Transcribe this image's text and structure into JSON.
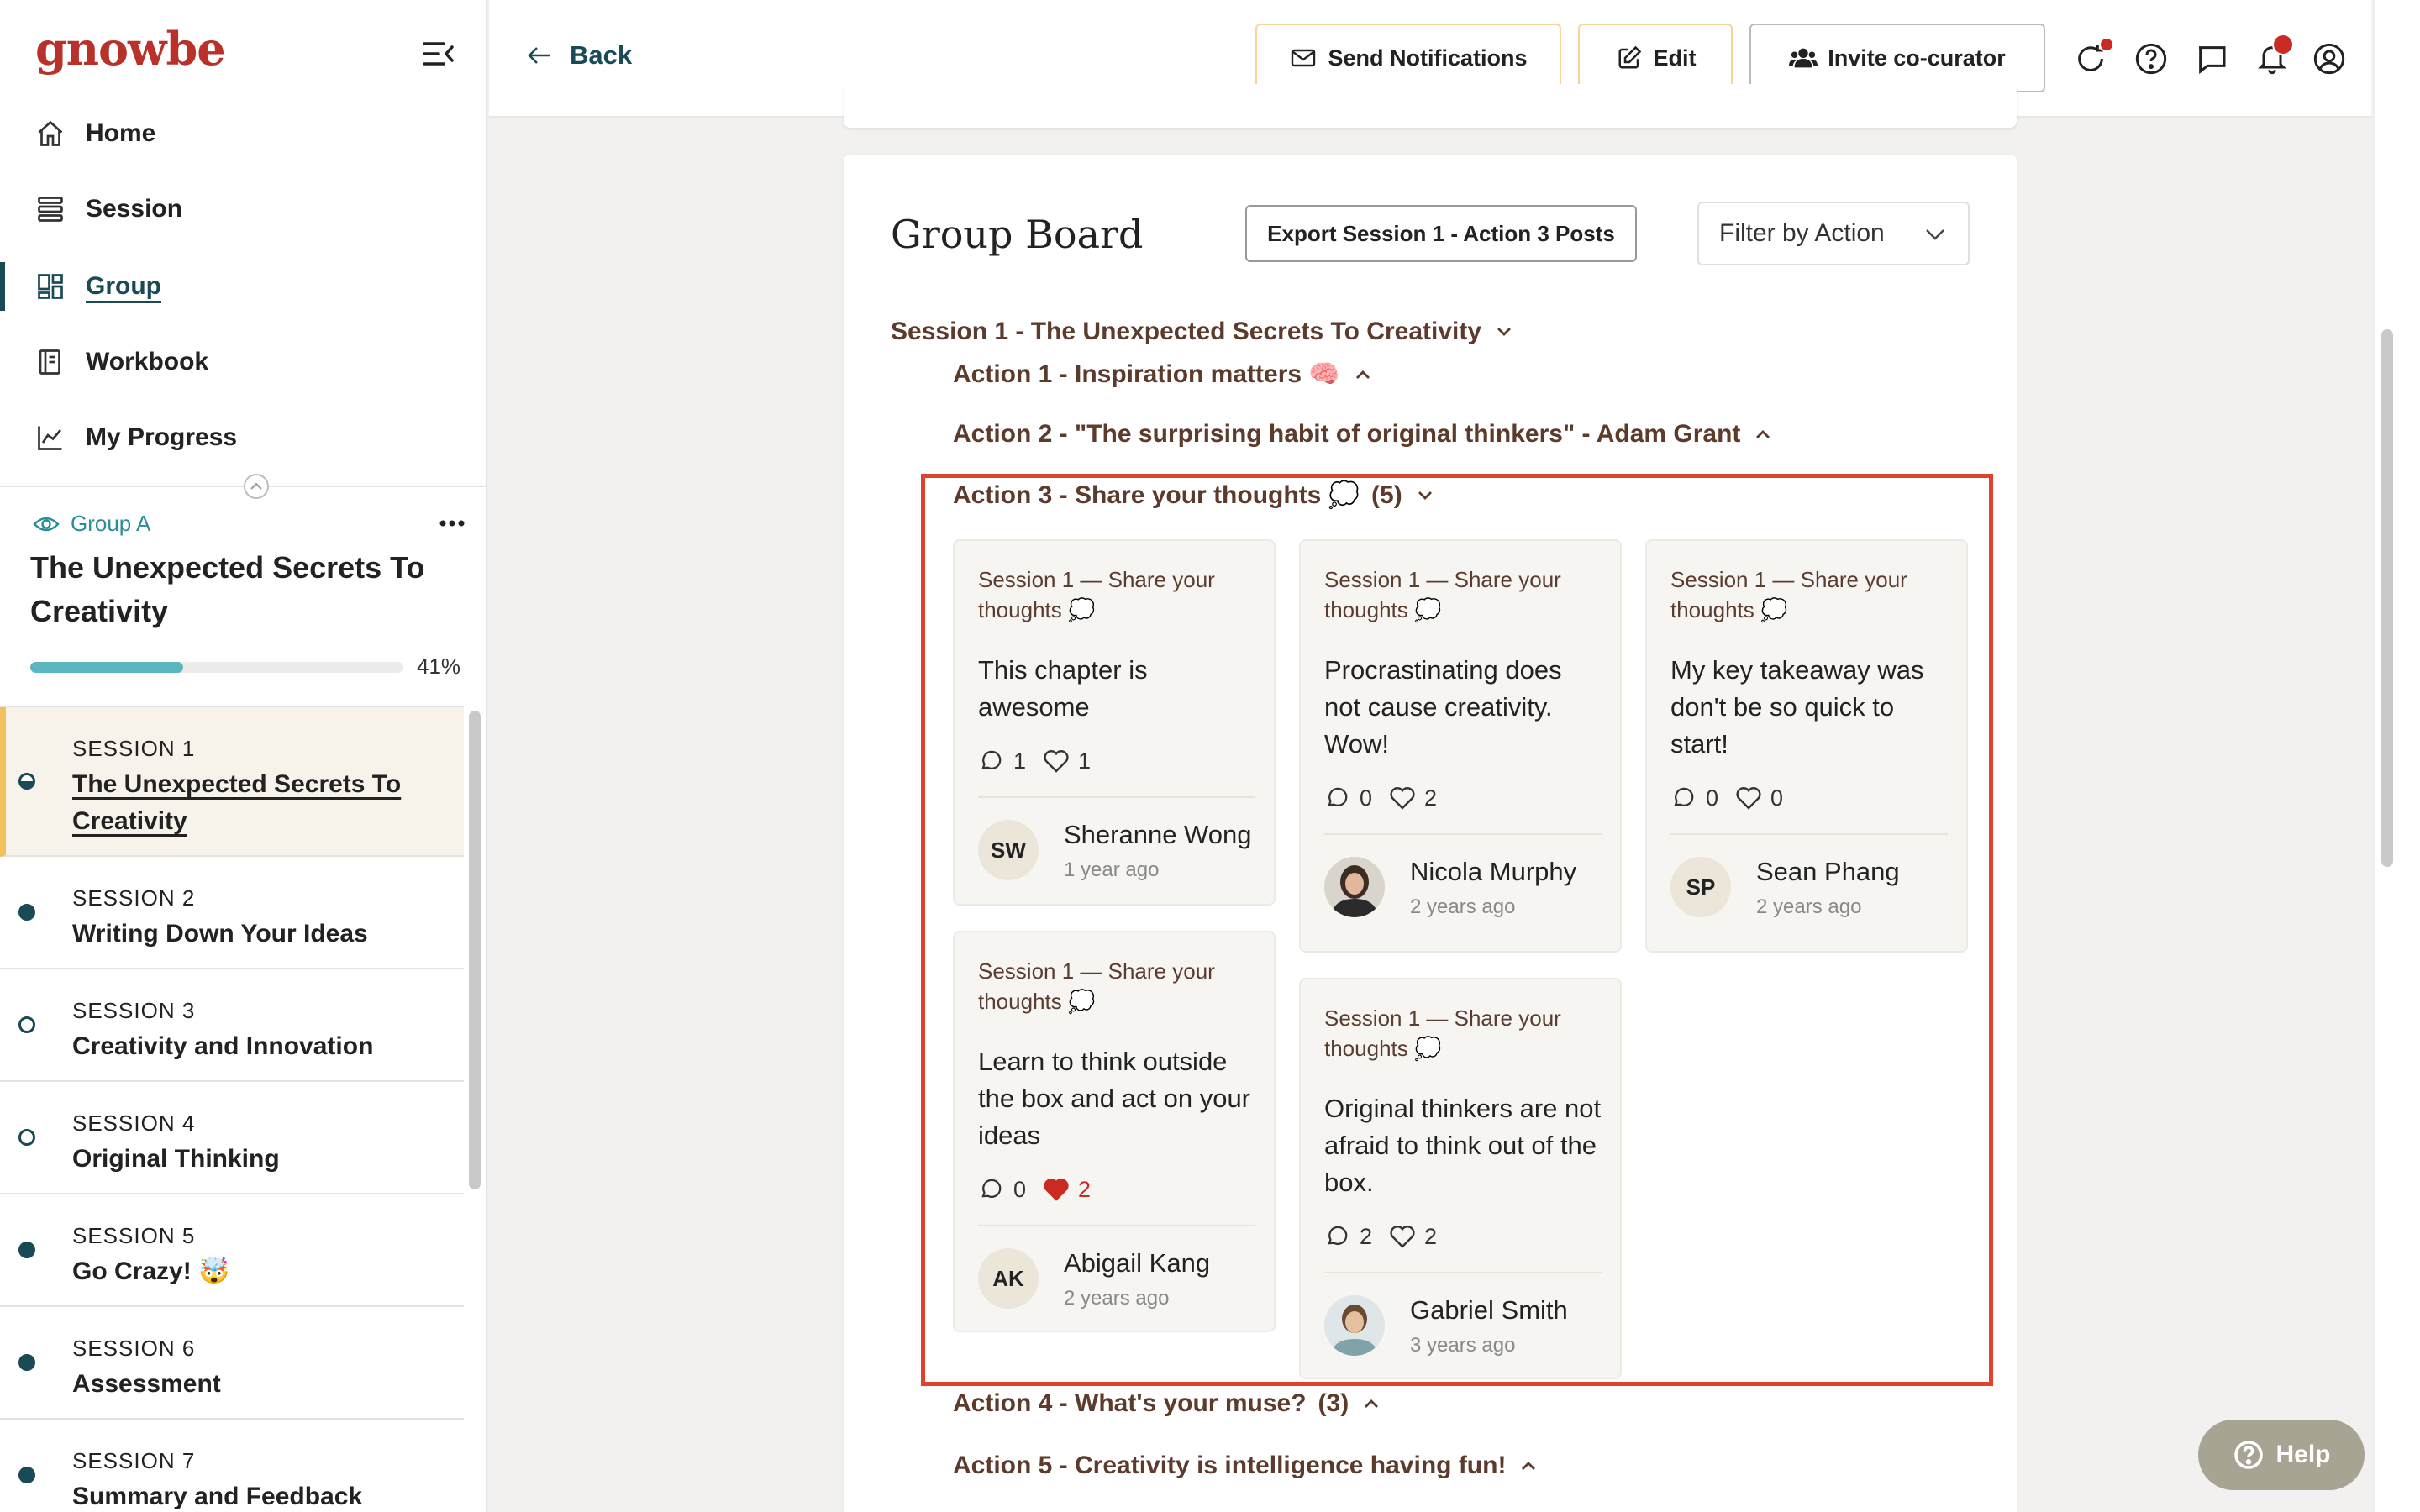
{
  "brand": {
    "logo": "gnowbe"
  },
  "nav": [
    {
      "label": "Home",
      "icon": "home-icon"
    },
    {
      "label": "Session",
      "icon": "stack-icon"
    },
    {
      "label": "Group",
      "icon": "dashboard-icon"
    },
    {
      "label": "Workbook",
      "icon": "notebook-icon"
    },
    {
      "label": "My Progress",
      "icon": "chart-line-icon"
    }
  ],
  "group": {
    "label": "Group A",
    "course_title": "The Unexpected Secrets To Creativity",
    "progress": {
      "percent": 41,
      "label": "41%"
    }
  },
  "sessions": [
    {
      "num": "SESSION 1",
      "name": "The Unexpected Secrets To Creativity",
      "active": true
    },
    {
      "num": "SESSION 2",
      "name": "Writing Down Your Ideas"
    },
    {
      "num": "SESSION 3",
      "name": "Creativity and Innovation"
    },
    {
      "num": "SESSION 4",
      "name": "Original Thinking"
    },
    {
      "num": "SESSION 5",
      "name": "Go Crazy! 🤯"
    },
    {
      "num": "SESSION 6",
      "name": "Assessment"
    },
    {
      "num": "SESSION 7",
      "name": "Summary and Feedback"
    }
  ],
  "header": {
    "back": "Back",
    "send_notifications": "Send Notifications",
    "edit": "Edit",
    "invite": "Invite co-curator"
  },
  "board": {
    "title": "Group Board",
    "export": "Export Session 1 - Action 3 Posts",
    "filter": "Filter by Action",
    "session_heading": "Session 1 - The Unexpected Secrets To Creativity",
    "actions": [
      {
        "label": "Action 1 - Inspiration matters 🧠",
        "count": ""
      },
      {
        "label": "Action 2 - \"The surprising habit of original thinkers\" - Adam Grant",
        "count": ""
      },
      {
        "label": "Action 3 - Share your thoughts 💭",
        "count": "(5)"
      },
      {
        "label": "Action 4 - What's your muse?",
        "count": "(3)"
      },
      {
        "label": "Action 5 - Creativity is intelligence having fun!",
        "count": ""
      }
    ],
    "posts": [
      {
        "context": "Session 1 — Share your thoughts 💭",
        "text": "This chapter is awesome",
        "comments": "1",
        "likes": "1",
        "liked": false,
        "author": "Sheranne Wong",
        "initials": "SW",
        "ago": "1 year ago"
      },
      {
        "context": "Session 1 — Share your thoughts 💭",
        "text": "Procrastinating does not cause creativity. Wow!",
        "comments": "0",
        "likes": "2",
        "liked": false,
        "author": "Nicola Murphy",
        "initials": "",
        "ago": "2 years ago"
      },
      {
        "context": "Session 1 — Share your thoughts 💭",
        "text": "My key takeaway was don't be so quick to start!",
        "comments": "0",
        "likes": "0",
        "liked": false,
        "author": "Sean Phang",
        "initials": "SP",
        "ago": "2 years ago"
      },
      {
        "context": "Session 1 — Share your thoughts 💭",
        "text": "Learn to think outside the box and act on your ideas",
        "comments": "0",
        "likes": "2",
        "liked": true,
        "author": "Abigail Kang",
        "initials": "AK",
        "ago": "2 years ago"
      },
      {
        "context": "Session 1 — Share your thoughts 💭",
        "text": "Original thinkers are not afraid to think out of the box.",
        "comments": "2",
        "likes": "2",
        "liked": false,
        "author": "Gabriel Smith",
        "initials": "",
        "ago": "3 years ago"
      }
    ]
  },
  "help": "Help",
  "colors": {
    "brand": "#b8322b",
    "accent": "#1a4a55",
    "highlight": "#e2412f",
    "liked": "#c92a22",
    "progress": "#5cb6c0"
  }
}
